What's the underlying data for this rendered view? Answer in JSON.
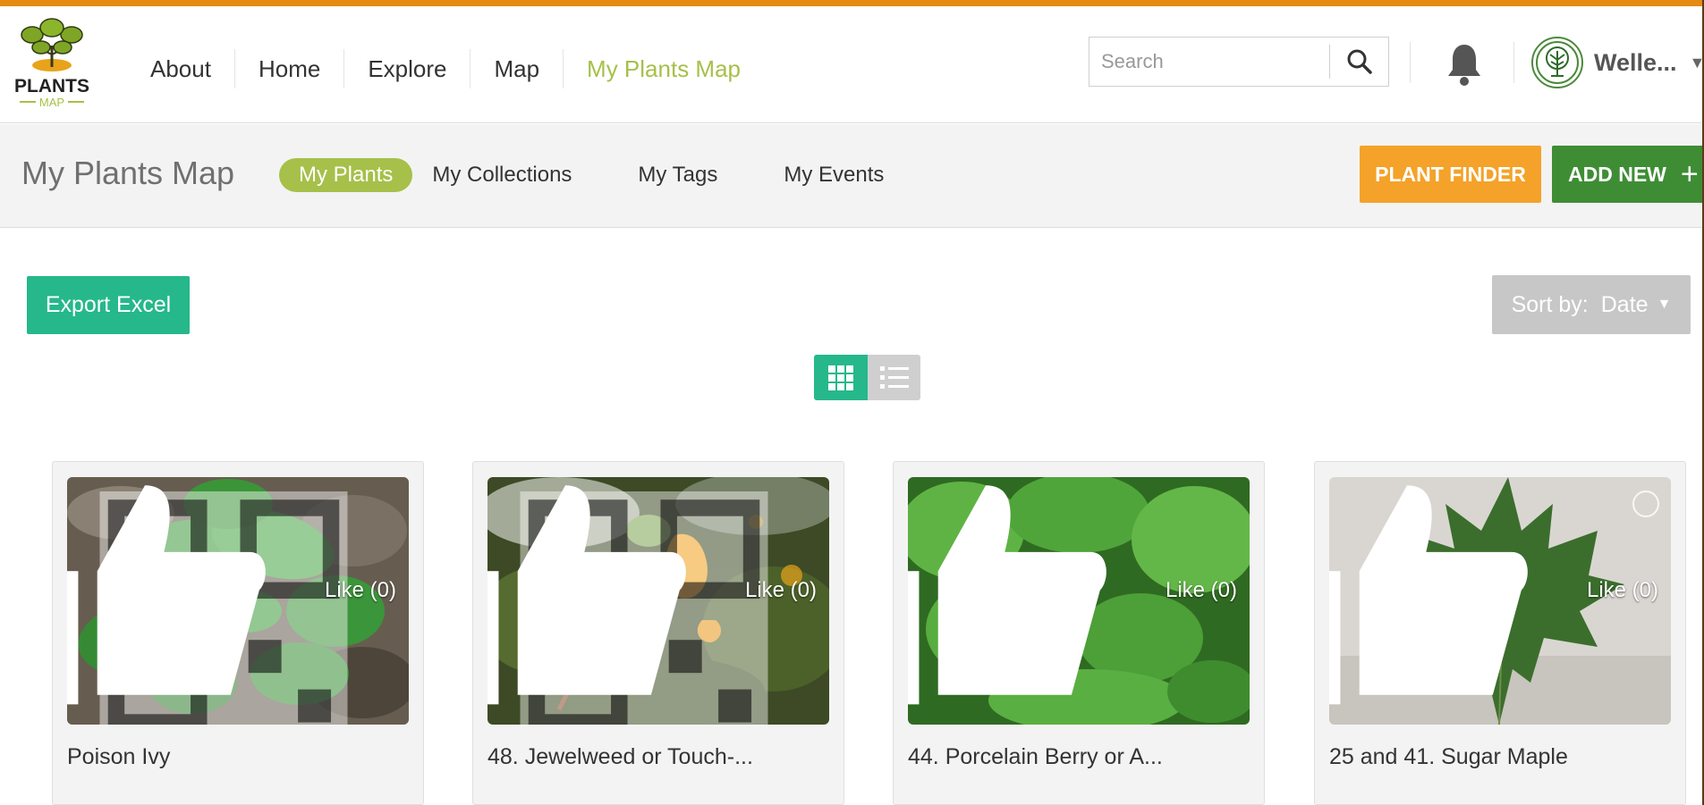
{
  "brand": {
    "logo_top": "PLANTS",
    "logo_bottom": "MAP",
    "accent_orange": "#e58a12",
    "accent_green": "#a6c04a"
  },
  "nav": {
    "items": [
      {
        "label": "About"
      },
      {
        "label": "Home"
      },
      {
        "label": "Explore"
      },
      {
        "label": "Map"
      },
      {
        "label": "My Plants Map",
        "active": true
      }
    ]
  },
  "search": {
    "placeholder": "Search",
    "value": ""
  },
  "user": {
    "name": "Welle...",
    "icon": "tree-avatar"
  },
  "subheader": {
    "title": "My Plants Map",
    "tabs": [
      {
        "label": "My Plants",
        "active": true
      },
      {
        "label": "My Collections"
      },
      {
        "label": "My Tags"
      },
      {
        "label": "My Events"
      }
    ],
    "plant_finder_label": "PLANT FINDER",
    "add_new_label": "ADD NEW",
    "add_new_icon": "+"
  },
  "toolbar": {
    "export_label": "Export Excel",
    "sort_label": "Sort by:",
    "sort_value": "Date",
    "view_mode": "grid"
  },
  "cards": [
    {
      "title": "Poison Ivy",
      "like_label": "Like (0)"
    },
    {
      "title": "48. Jewelweed or Touch-...",
      "like_label": "Like (0)"
    },
    {
      "title": "44. Porcelain Berry or A...",
      "like_label": "Like (0)"
    },
    {
      "title": "25 and 41. Sugar Maple",
      "like_label": "Like (0)"
    }
  ]
}
